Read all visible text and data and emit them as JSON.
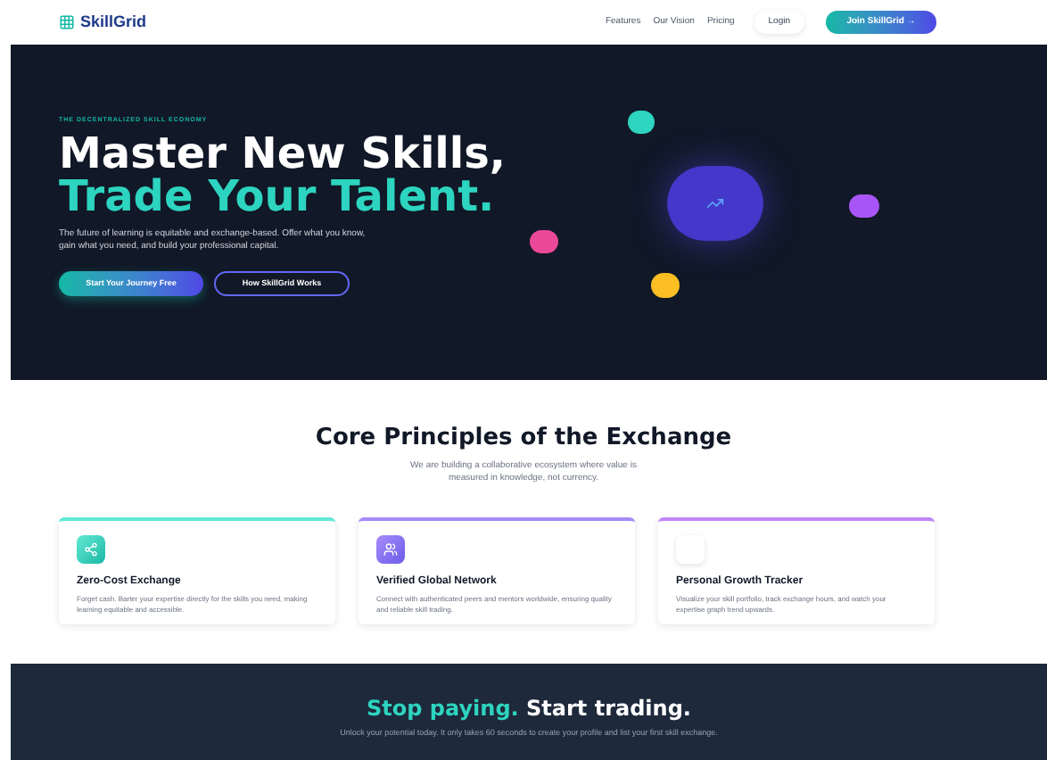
{
  "nav": {
    "brand": "SkillGrid",
    "links": [
      "Features",
      "Our Vision",
      "Pricing"
    ],
    "login": "Login",
    "join": "Join SkillGrid →"
  },
  "hero": {
    "eyebrow": "THE DECENTRALIZED SKILL ECONOMY",
    "title_line_1": "Master New Skills,",
    "title_line_2": "Trade Your Talent.",
    "text": "The future of learning is equitable and exchange-based. Offer what you know, gain what you need, and build your professional capital.",
    "primary_button": "Start Your Journey Free",
    "secondary_button": "How SkillGrid Works"
  },
  "principles": {
    "title": "Core Principles of the Exchange",
    "subtitle": "We are building a collaborative ecosystem where value is measured in knowledge, not currency.",
    "cards": [
      {
        "kind": "share",
        "title": "Zero-Cost Exchange",
        "text": "Forget cash. Barter your expertise directly for the skills you need, making learning equitable and accessible."
      },
      {
        "kind": "people",
        "title": "Verified Global Network",
        "text": "Connect with authenticated peers and mentors worldwide, ensuring quality and reliable skill trading."
      },
      {
        "kind": "blank",
        "title": "Personal Growth Tracker",
        "text": "Visualize your skill portfolio, track exchange hours, and watch your expertise graph trend upwards."
      }
    ]
  },
  "cta": {
    "title_accent": "Stop paying.",
    "title_rest": "Start trading.",
    "text": "Unlock your potential today. It only takes 60 seconds to create your profile and list your first skill exchange."
  }
}
